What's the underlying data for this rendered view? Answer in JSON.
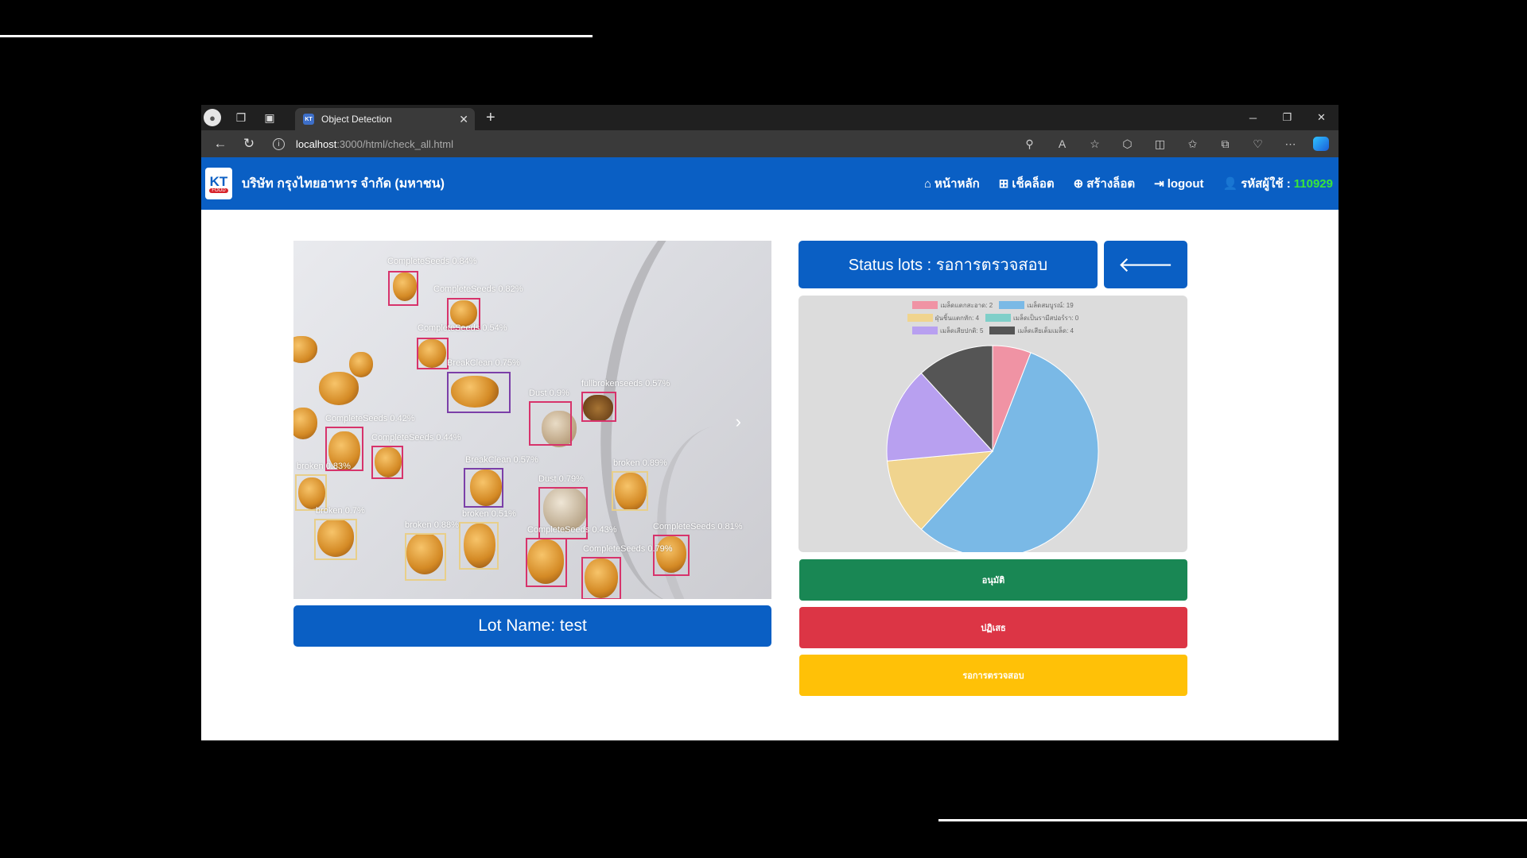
{
  "browser": {
    "tab_title": "Object Detection",
    "url_host": "localhost",
    "url_path": ":3000/html/check_all.html"
  },
  "navbar": {
    "brand": "บริษัท กรุงไทยอาหาร จำกัด (มหาชน)",
    "logo_text": "KT",
    "logo_sub": "FOOD",
    "menu": [
      {
        "label": "หน้าหลัก",
        "icon": "home-icon"
      },
      {
        "label": "เช็คล็อต",
        "icon": "sitemap-icon"
      },
      {
        "label": "สร้างล็อต",
        "icon": "plus-circle-icon"
      },
      {
        "label": "logout",
        "icon": "sign-out-icon"
      }
    ],
    "user_label": "รหัสผู้ใช้ :",
    "user_id": "110929"
  },
  "detection": {
    "labels": [
      "CompleteSeeds 0.84%",
      "CompleteSeeds 0.82%",
      "CompleteSeeds 0.54%",
      "BreakClean 0.75%",
      "Dust 0.9%",
      "fullbrokenseeds 0.57%",
      "CompleteSeeds 0.42%",
      "CompleteSeeds 0.44%",
      "BreakClean 0.57%",
      "broken 0.83%",
      "Dust 0.79%",
      "broken 0.89%",
      "broken 0.7%",
      "broken 0.51%",
      "broken 0.88%",
      "CompleteSeeds 0.43%",
      "CompleteSeeds 0.81%",
      "CompleteSeeds 0.79%"
    ]
  },
  "lot_name": "Lot Name: test",
  "status_text": "Status lots : รอการตรวจสอบ",
  "chart_data": {
    "type": "pie",
    "series": [
      {
        "label": "เมล็ดแตกสะอาด: 2",
        "value": 2,
        "color": "#f093a4"
      },
      {
        "label": "เมล็ดสมบูรณ์: 19",
        "value": 19,
        "color": "#7ab9e6"
      },
      {
        "label": "ฝุ่นชิ้นแตกหัก: 4",
        "value": 4,
        "color": "#f0d48e"
      },
      {
        "label": "เมล็ดเป็นรามีสปอร์รา: 0",
        "value": 0,
        "color": "#7fcfc9"
      },
      {
        "label": "เมล็ดเสียปกติ: 5",
        "value": 5,
        "color": "#b8a0f0"
      },
      {
        "label": "เมล็ดเสียเต็มเมล็ด: 4",
        "value": 4,
        "color": "#555555"
      }
    ],
    "legend_position": "top"
  },
  "actions": {
    "approve": "อนุมัติ",
    "reject": "ปฏิเสธ",
    "pending": "รอการตรวจสอบ"
  }
}
